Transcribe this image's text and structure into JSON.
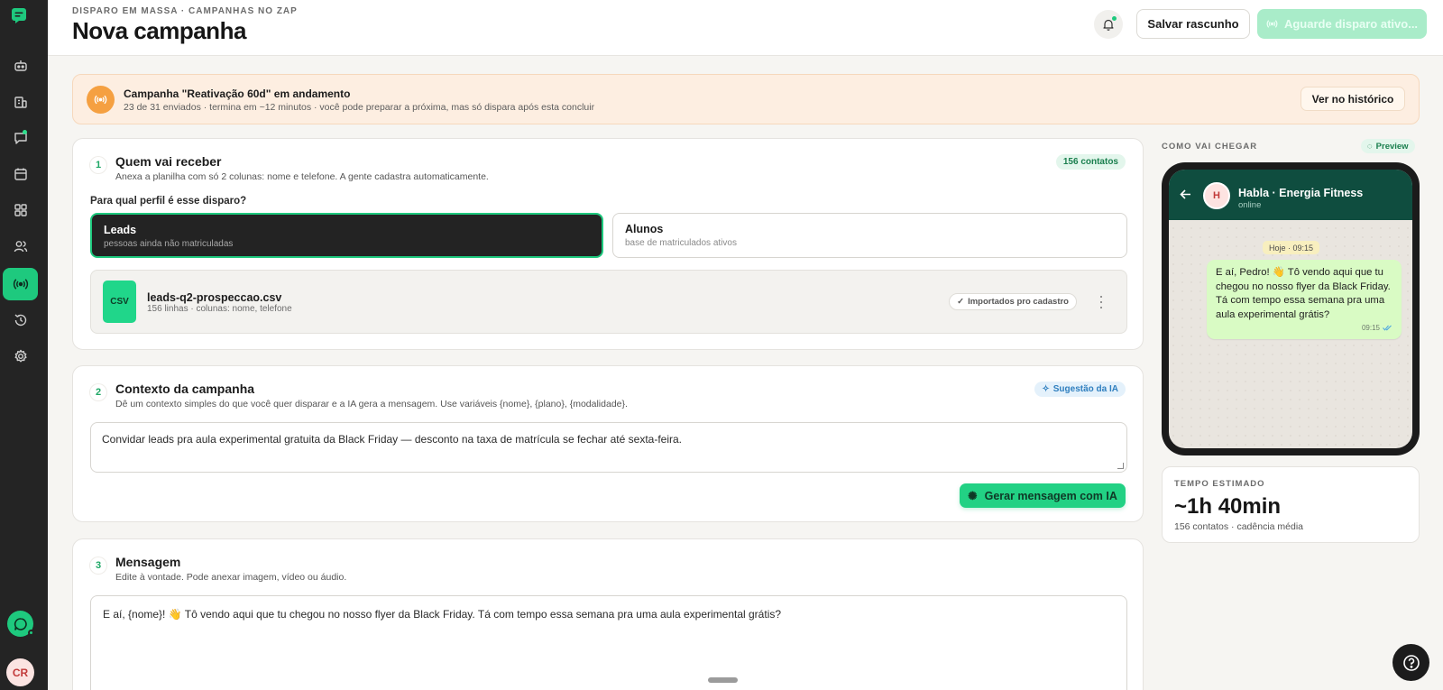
{
  "sidebar": {
    "items": [
      {
        "icon": "bot-icon",
        "active": false
      },
      {
        "icon": "building-icon",
        "active": false
      },
      {
        "icon": "chat-icon",
        "active": false,
        "badge": true
      },
      {
        "icon": "calendar-icon",
        "active": false
      },
      {
        "icon": "apps-grid-icon",
        "active": false
      },
      {
        "icon": "users-icon",
        "active": false
      },
      {
        "icon": "broadcast-icon",
        "active": true
      },
      {
        "icon": "history-icon",
        "active": false
      },
      {
        "icon": "settings-icon",
        "active": false
      }
    ],
    "avatar_initials": "CR"
  },
  "header": {
    "eyebrow": "DISPARO EM MASSA · CAMPANHAS NO ZAP",
    "title": "Nova campanha",
    "save_draft_label": "Salvar rascunho",
    "wait_label": "Aguarde disparo ativo..."
  },
  "alert": {
    "title": "Campanha \"Reativação 60d\" em andamento",
    "subtitle": "23 de 31 enviados · termina em ~12 minutos · você pode preparar a próxima, mas só dispara após esta concluir",
    "button_label": "Ver no histórico",
    "accent_color": "#f5a041"
  },
  "step1": {
    "number": "1",
    "title": "Quem vai receber",
    "subtitle": "Anexa a planilha com só 2 colunas: nome e telefone. A gente cadastra automaticamente.",
    "badge": "156 contatos",
    "profile_question": "Para qual perfil é esse disparo?",
    "options": [
      {
        "title": "Leads",
        "subtitle": "pessoas ainda não matriculadas",
        "selected": true
      },
      {
        "title": "Alunos",
        "subtitle": "base de matriculados ativos",
        "selected": false
      }
    ],
    "file": {
      "badge": "CSV",
      "name": "leads-q2-prospeccao.csv",
      "meta": "156 linhas · colunas: nome, telefone",
      "status": "Importados pro cadastro"
    }
  },
  "step2": {
    "number": "2",
    "title": "Contexto da campanha",
    "subtitle": "Dê um contexto simples do que você quer disparar e a IA gera a mensagem. Use variáveis {nome}, {plano}, {modalidade}.",
    "badge": "Sugestão da IA",
    "context_value": "Convidar leads pra aula experimental gratuita da Black Friday — desconto na taxa de matrícula se fechar até sexta-feira.",
    "generate_label": "Gerar mensagem com IA"
  },
  "step3": {
    "number": "3",
    "title": "Mensagem",
    "subtitle": "Edite à vontade. Pode anexar imagem, vídeo ou áudio.",
    "message_value": "E aí, {nome}! 👋 Tô vendo aqui que tu chegou no nosso flyer da Black Friday. Tá com tempo essa semana pra uma aula experimental grátis?"
  },
  "preview": {
    "label": "COMO VAI CHEGAR",
    "badge": "Preview",
    "contact_initial": "H",
    "contact_name": "Habla · Energia Fitness",
    "contact_status": "online",
    "date_chip": "Hoje · 09:15",
    "bubble_text": "E aí, Pedro! 👋 Tô vendo aqui que tu chegou no nosso flyer da Black Friday. Tá com tempo essa semana pra uma aula experimental grátis?",
    "bubble_time": "09:15"
  },
  "estimate": {
    "label": "TEMPO ESTIMADO",
    "value": "~1h 40min",
    "subtitle": "156 contatos · cadência média"
  },
  "colors": {
    "brand_green": "#1ec97e",
    "sidebar_bg": "#242424",
    "whatsapp_header": "#0f4d3f"
  }
}
